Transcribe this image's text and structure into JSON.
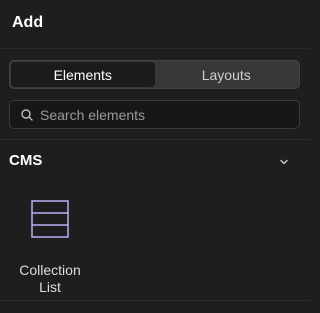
{
  "header": {
    "title": "Add"
  },
  "tabs": [
    {
      "label": "Elements",
      "active": true
    },
    {
      "label": "Layouts",
      "active": false
    }
  ],
  "search": {
    "placeholder": "Search elements",
    "value": "",
    "icon": "search-icon"
  },
  "sections": [
    {
      "title": "CMS",
      "icon": "chevron-down-icon",
      "items": [
        {
          "label": "Collection List",
          "icon": "collection-list-icon"
        }
      ]
    }
  ],
  "colors": {
    "background": "#1e1e1e",
    "tab_active": "#1b1b1b",
    "tab_track": "#383838",
    "icon_accent": "#b9aef5"
  }
}
